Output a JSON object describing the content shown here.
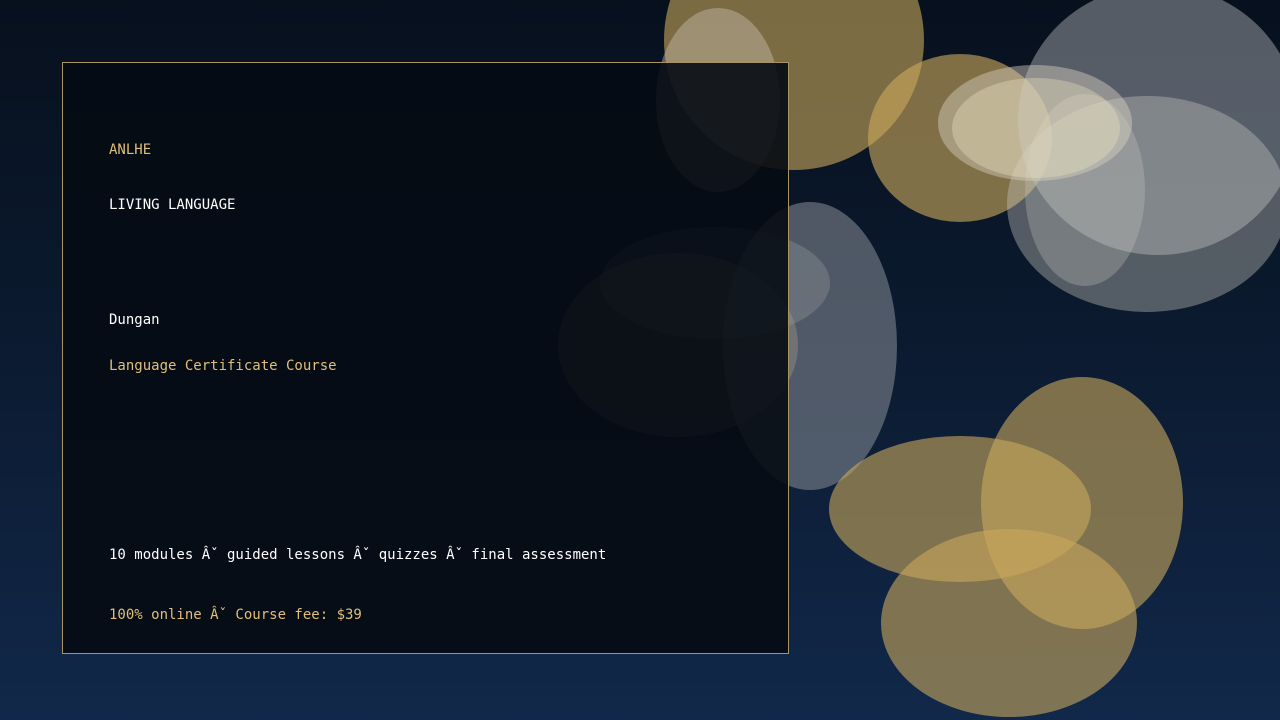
{
  "brand": "ANLHE",
  "tagline": "LIVING LANGUAGE",
  "course": {
    "language": "Dungan",
    "title": "Language Certificate Course",
    "features": "10 modules Âˇ guided lessons Âˇ quizzes Âˇ final assessment",
    "pricing": "100% online Âˇ Course fee: $39"
  },
  "colors": {
    "accent_gold": "#e1bf7a",
    "panel_border": "#a89460",
    "background_top": "#07101d",
    "background_bottom": "#11284a"
  }
}
